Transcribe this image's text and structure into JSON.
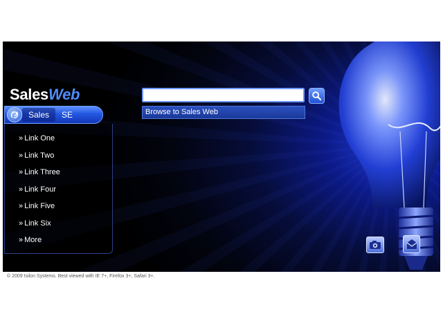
{
  "logo": {
    "part1": "Sales",
    "part2": "Web"
  },
  "tabs": [
    {
      "label": "Sales",
      "active": true
    },
    {
      "label": "SE",
      "active": false
    }
  ],
  "links": [
    {
      "label": "Link One"
    },
    {
      "label": "Link Two"
    },
    {
      "label": "Link Three"
    },
    {
      "label": "Link Four"
    },
    {
      "label": "Link Five"
    },
    {
      "label": "Link Six"
    },
    {
      "label": "More"
    }
  ],
  "link_prefix": "»",
  "search": {
    "value": "",
    "placeholder": ""
  },
  "browse": {
    "label": "Browse to Sales Web"
  },
  "footer": {
    "text": "© 2009 Isilon Systems. Best viewed with IE 7+, Firefox 3+, Safari 3+."
  },
  "icons": {
    "tab_logo": "swirl-logo-icon",
    "search": "search-icon",
    "camera": "camera-icon",
    "mail": "mail-icon",
    "bulb": "lightbulb-image"
  },
  "colors": {
    "background": "#000000",
    "accent": "#4f8cff",
    "tab_blue": "#2357e0",
    "text": "#ffffff"
  }
}
